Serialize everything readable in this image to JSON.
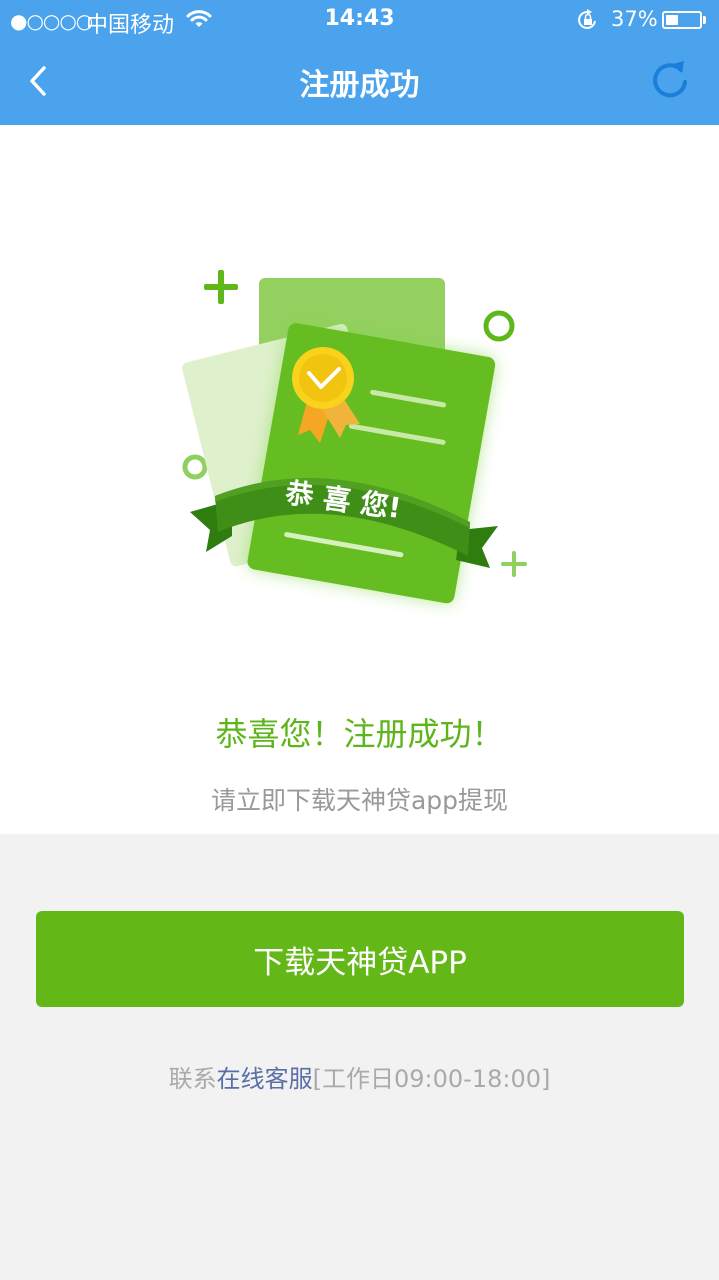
{
  "status_bar": {
    "signal": "●○○○○",
    "carrier": "中国移动",
    "time": "14:43",
    "battery_percent": "37%",
    "battery_level": 0.37
  },
  "nav": {
    "title": "注册成功",
    "back_icon": "chevron-left-icon",
    "refresh_icon": "refresh-icon"
  },
  "illustration": {
    "ribbon_text": "恭 喜 您!"
  },
  "main": {
    "success_title": "恭喜您！注册成功！",
    "success_subtitle": "请立即下载天神贷app提现"
  },
  "actions": {
    "download_label": "下载天神贷APP"
  },
  "contact": {
    "prefix": "联系",
    "link": "在线客服",
    "hours": "[工作日09:00-18:00]"
  },
  "colors": {
    "nav_bg": "#4aa3ec",
    "accent_green": "#63b818",
    "link_blue": "#5a6fa6",
    "page_bg": "#f2f2f2"
  }
}
